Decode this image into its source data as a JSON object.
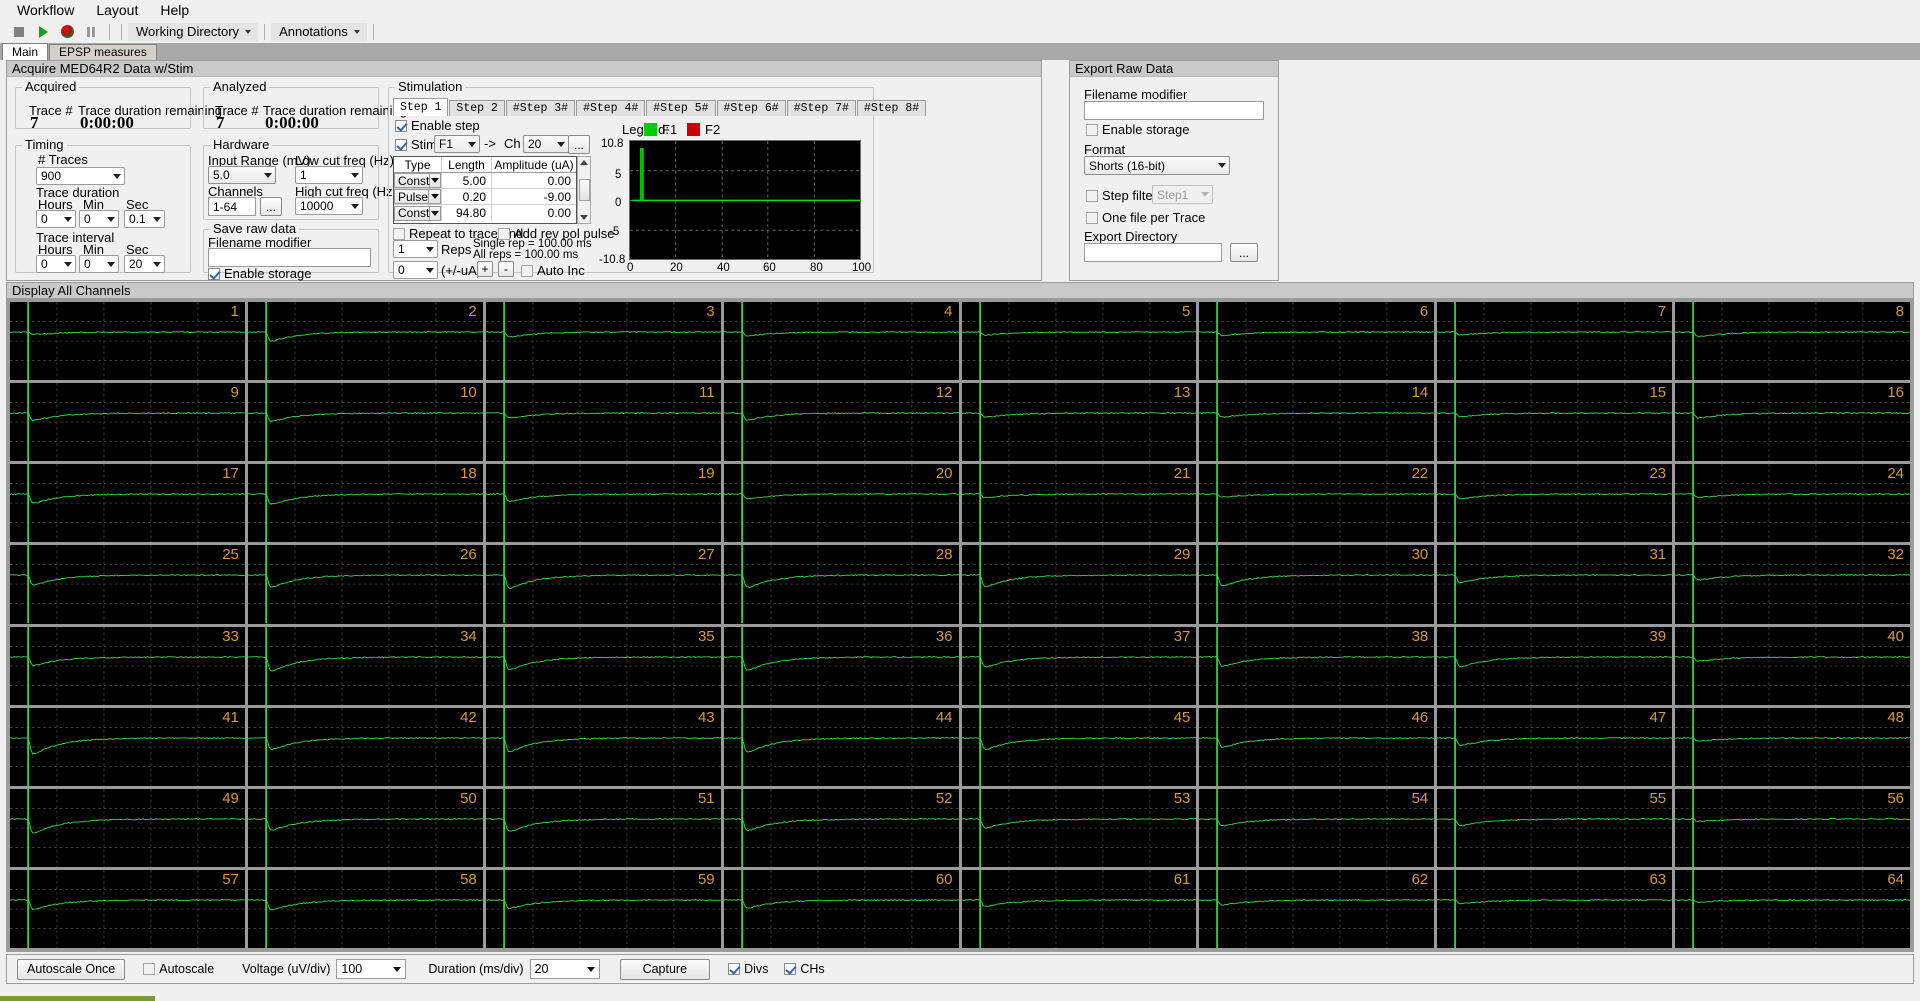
{
  "menubar": {
    "items": [
      "Workflow",
      "Layout",
      "Help"
    ]
  },
  "toolbar": {
    "icons": [
      "stop-icon",
      "play-icon",
      "record-icon",
      "pause-icon"
    ],
    "working_directory": "Working Directory",
    "annotations": "Annotations"
  },
  "tabs": [
    {
      "label": "Main",
      "active": true
    },
    {
      "label": "EPSP measures",
      "active": false
    }
  ],
  "acquire_panel": {
    "title": "Acquire MED64R2 Data w/Stim",
    "acquired": {
      "group_label": "Acquired",
      "trace_label": "Trace #",
      "trace_value": "7",
      "duration_label": "Trace duration remaining",
      "duration_value": "0:00:00"
    },
    "timing": {
      "group_label": "Timing",
      "ntraces_label": "# Traces",
      "ntraces_value": "900",
      "duration_label": "Trace duration",
      "hours_label": "Hours",
      "min_label": "Min",
      "sec_label": "Sec",
      "duration_hours": "0",
      "duration_min": "0",
      "duration_sec": "0.1",
      "interval_label": "Trace interval",
      "interval_hours_label": "Hours",
      "interval_min_label": "Min",
      "interval_sec_label": "Sec",
      "interval_hours": "0",
      "interval_min": "0",
      "interval_sec": "20"
    }
  },
  "analyzed_panel": {
    "analyzed": {
      "group_label": "Analyzed",
      "trace_label": "Trace #",
      "trace_value": "7",
      "duration_label": "Trace duration remaining",
      "duration_value": "0:00:00"
    },
    "hardware": {
      "group_label": "Hardware",
      "input_range_label": "Input Range (mV)",
      "input_range_value": "5.0",
      "low_cut_label": "Low cut freq (Hz)",
      "low_cut_value": "1",
      "channels_label": "Channels",
      "channels_value": "1-64",
      "channels_browse": "...",
      "high_cut_label": "High cut freq (Hz)",
      "high_cut_value": "10000"
    },
    "save_raw": {
      "group_label": "Save raw data",
      "filename_label": "Filename modifier",
      "filename_value": "",
      "enable_storage_label": "Enable storage",
      "enable_storage_checked": true
    }
  },
  "stimulation_panel": {
    "title": "Stimulation",
    "step_tabs": [
      {
        "label": "Step 1",
        "active": true
      },
      {
        "label": "Step 2",
        "active": false
      },
      {
        "label": "#Step 3#",
        "active": false
      },
      {
        "label": "#Step 4#",
        "active": false
      },
      {
        "label": "#Step 5#",
        "active": false
      },
      {
        "label": "#Step 6#",
        "active": false
      },
      {
        "label": "#Step 7#",
        "active": false
      },
      {
        "label": "#Step 8#",
        "active": false
      }
    ],
    "enable_step_label": "Enable step",
    "enable_step_checked": true,
    "stim_label": "Stim",
    "stim_checked": true,
    "stim_source": "F1",
    "arrow": "->",
    "ch_label": "Ch",
    "ch_value": "20",
    "ch_browse": "...",
    "table_headers": [
      "Type",
      "Length",
      "Amplitude (uA)"
    ],
    "table_rows": [
      {
        "type": "Const",
        "length": "5.00",
        "amplitude": "0.00"
      },
      {
        "type": "Pulse",
        "length": "0.20",
        "amplitude": "-9.00"
      },
      {
        "type": "Const",
        "length": "94.80",
        "amplitude": "0.00"
      }
    ],
    "repeat_to_trace_end_label": "Repeat to trace end",
    "repeat_to_trace_end_checked": false,
    "add_rev_pol_pulse_label": "Add rev pol pulse",
    "add_rev_pol_pulse_checked": false,
    "reps_value": "1",
    "reps_label": "Reps",
    "single_rep_text": "Single rep = 100.00 ms",
    "all_reps_text": "All reps = 100.00 ms",
    "ua_value": "0",
    "ua_label": "(+/-uA)",
    "plus_label": "+",
    "minus_label": "-",
    "auto_inc_label": "Auto Inc",
    "auto_inc_checked": false,
    "legend_label": "Legend:",
    "legend_items": [
      {
        "name": "F1",
        "color": "#00cc00"
      },
      {
        "name": "F2",
        "color": "#cc0000"
      }
    ],
    "graph": {
      "y_ticks": [
        "10.8",
        "5",
        "0",
        "-5",
        "-10.8"
      ],
      "x_ticks": [
        "0",
        "20",
        "40",
        "60",
        "80",
        "100"
      ],
      "trace_color": "#00dd00"
    }
  },
  "export_panel": {
    "title": "Export Raw Data",
    "filename_label": "Filename modifier",
    "filename_value": "",
    "enable_storage_label": "Enable storage",
    "enable_storage_checked": false,
    "format_label": "Format",
    "format_value": "Shorts (16-bit)",
    "step_filter_label": "Step filter",
    "step_filter_checked": false,
    "step_filter_value": "Step1",
    "one_file_label": "One file per Trace",
    "one_file_checked": false,
    "export_dir_label": "Export Directory",
    "export_dir_value": "",
    "export_dir_browse": "..."
  },
  "display_panel": {
    "header": "Display All Channels",
    "channel_count": 64,
    "channel_numbers": [
      1,
      2,
      3,
      4,
      5,
      6,
      7,
      8,
      9,
      10,
      11,
      12,
      13,
      14,
      15,
      16,
      17,
      18,
      19,
      20,
      21,
      22,
      23,
      24,
      25,
      26,
      27,
      28,
      29,
      30,
      31,
      32,
      33,
      34,
      35,
      36,
      37,
      38,
      39,
      40,
      41,
      42,
      43,
      44,
      45,
      46,
      47,
      48,
      49,
      50,
      51,
      52,
      53,
      54,
      55,
      56,
      57,
      58,
      59,
      60,
      61,
      62,
      63,
      64
    ],
    "trace_color": "#33dd44",
    "stim_marker_color": "#33ee44",
    "grid_color": "#555555",
    "number_color": "#d99a2b",
    "background_color": "#000000"
  },
  "bottom_bar": {
    "autoscale_once_label": "Autoscale Once",
    "autoscale_label": "Autoscale",
    "autoscale_checked": false,
    "voltage_label": "Voltage (uV/div)",
    "voltage_value": "100",
    "duration_label": "Duration (ms/div)",
    "duration_value": "20",
    "capture_label": "Capture",
    "divs_label": "Divs",
    "divs_checked": true,
    "chs_label": "CHs",
    "chs_checked": true
  }
}
